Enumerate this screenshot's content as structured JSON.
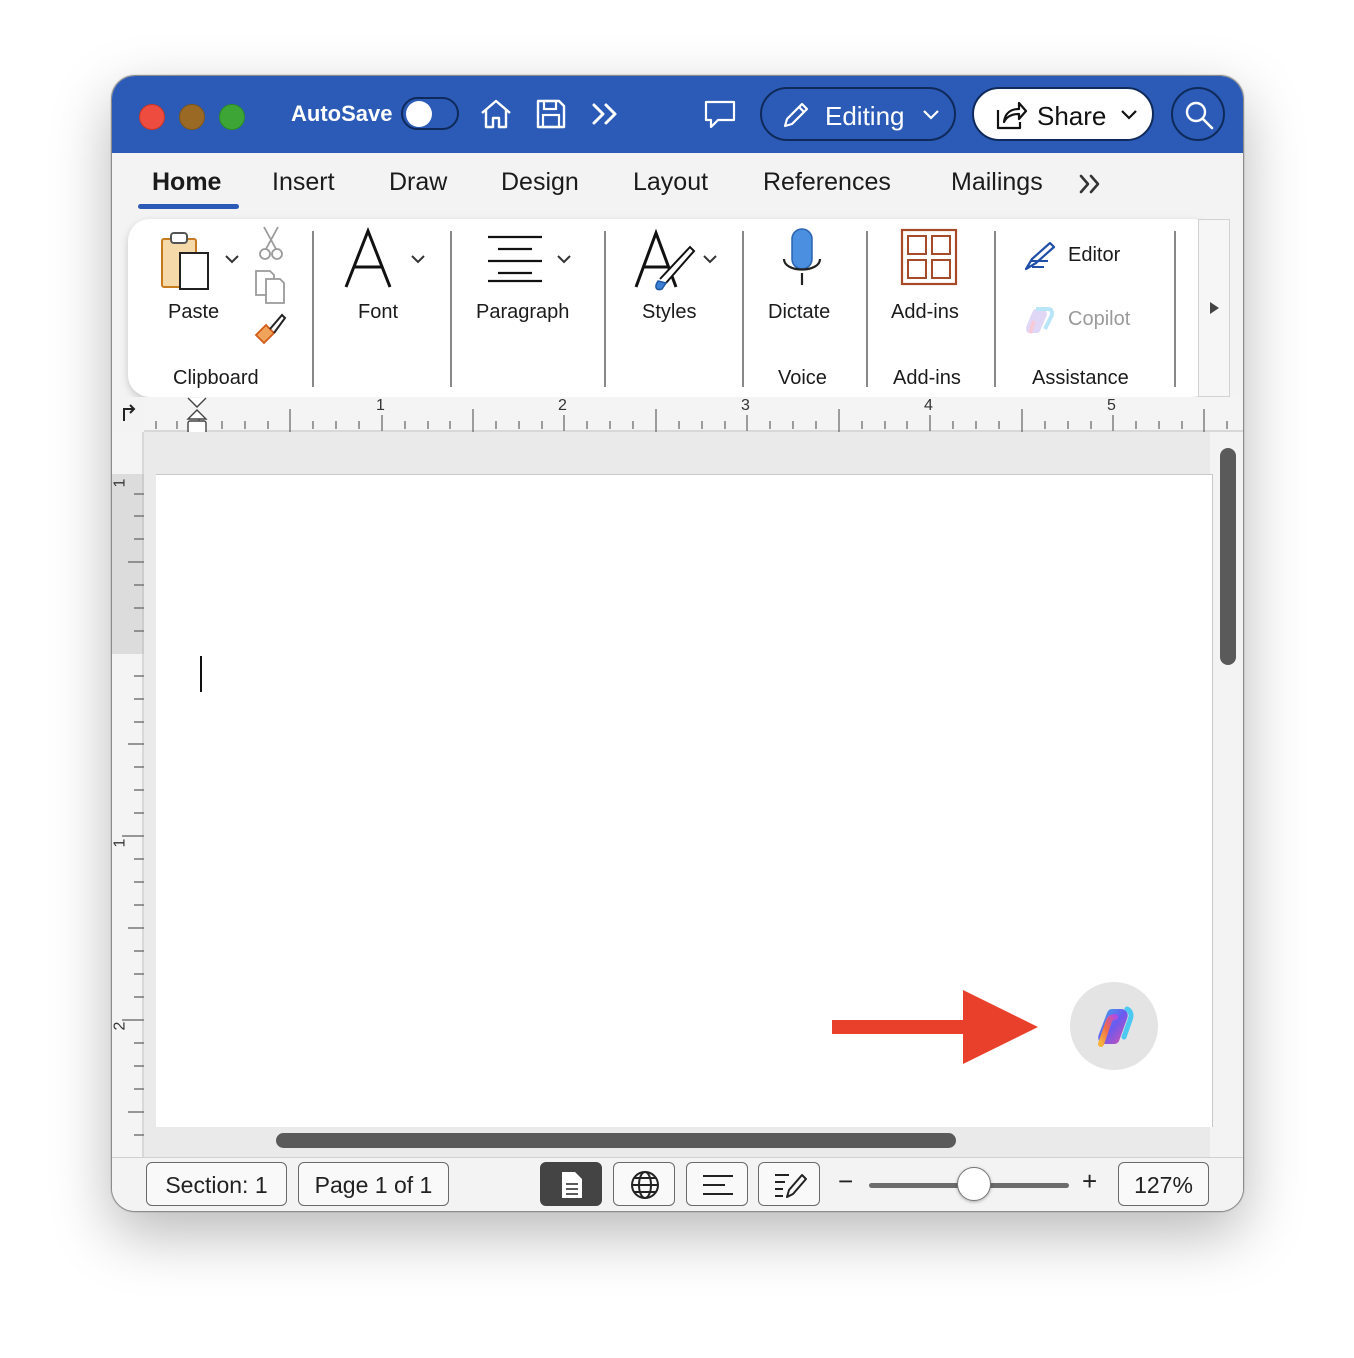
{
  "titlebar": {
    "autosave_label": "AutoSave",
    "autosave_on": false,
    "editing_label": "Editing",
    "share_label": "Share"
  },
  "tabs": [
    {
      "label": "Home",
      "active": true
    },
    {
      "label": "Insert"
    },
    {
      "label": "Draw"
    },
    {
      "label": "Design"
    },
    {
      "label": "Layout"
    },
    {
      "label": "References"
    },
    {
      "label": "Mailings"
    }
  ],
  "ribbon": {
    "paste": "Paste",
    "clipboard_group": "Clipboard",
    "font": "Font",
    "paragraph": "Paragraph",
    "styles": "Styles",
    "dictate": "Dictate",
    "voice_group": "Voice",
    "addins": "Add-ins",
    "addins_group": "Add-ins",
    "editor": "Editor",
    "copilot": "Copilot",
    "assistance_group": "Assistance"
  },
  "ruler": {
    "horizontal": [
      "1",
      "2",
      "3",
      "4",
      "5"
    ],
    "vertical": [
      "1",
      "1",
      "2"
    ]
  },
  "statusbar": {
    "section": "Section: 1",
    "page": "Page 1 of 1",
    "zoom_minus": "−",
    "zoom_plus": "+",
    "zoom_level": "127%"
  },
  "colors": {
    "titlebar": "#2b5bb6",
    "accent": "#2b5bb6",
    "annotation_arrow": "#e8402a"
  },
  "icons": [
    "home-icon",
    "save-icon",
    "more-icon",
    "comment-icon",
    "pencil-icon",
    "share-icon",
    "search-icon",
    "clipboard-icon",
    "scissors-icon",
    "copy-icon",
    "format-painter-icon",
    "font-icon",
    "paragraph-icon",
    "styles-icon",
    "microphone-icon",
    "addins-icon",
    "editor-icon",
    "copilot-icon"
  ]
}
